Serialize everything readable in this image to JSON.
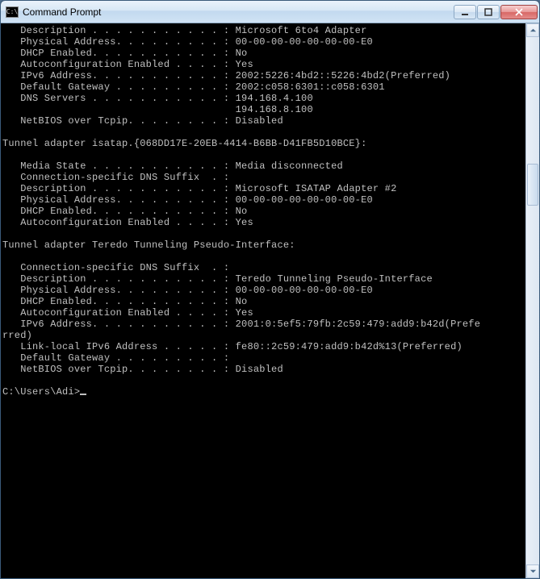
{
  "window": {
    "title": "Command Prompt",
    "icon_label": "C:\\"
  },
  "terminal": {
    "lines": [
      "   Description . . . . . . . . . . . : Microsoft 6to4 Adapter",
      "   Physical Address. . . . . . . . . : 00-00-00-00-00-00-00-E0",
      "   DHCP Enabled. . . . . . . . . . . : No",
      "   Autoconfiguration Enabled . . . . : Yes",
      "   IPv6 Address. . . . . . . . . . . : 2002:5226:4bd2::5226:4bd2(Preferred)",
      "   Default Gateway . . . . . . . . . : 2002:c058:6301::c058:6301",
      "   DNS Servers . . . . . . . . . . . : 194.168.4.100",
      "                                       194.168.8.100",
      "   NetBIOS over Tcpip. . . . . . . . : Disabled",
      "",
      "Tunnel adapter isatap.{068DD17E-20EB-4414-B6BB-D41FB5D10BCE}:",
      "",
      "   Media State . . . . . . . . . . . : Media disconnected",
      "   Connection-specific DNS Suffix  . :",
      "   Description . . . . . . . . . . . : Microsoft ISATAP Adapter #2",
      "   Physical Address. . . . . . . . . : 00-00-00-00-00-00-00-E0",
      "   DHCP Enabled. . . . . . . . . . . : No",
      "   Autoconfiguration Enabled . . . . : Yes",
      "",
      "Tunnel adapter Teredo Tunneling Pseudo-Interface:",
      "",
      "   Connection-specific DNS Suffix  . :",
      "   Description . . . . . . . . . . . : Teredo Tunneling Pseudo-Interface",
      "   Physical Address. . . . . . . . . : 00-00-00-00-00-00-00-E0",
      "   DHCP Enabled. . . . . . . . . . . : No",
      "   Autoconfiguration Enabled . . . . : Yes",
      "   IPv6 Address. . . . . . . . . . . : 2001:0:5ef5:79fb:2c59:479:add9:b42d(Prefe",
      "rred)",
      "   Link-local IPv6 Address . . . . . : fe80::2c59:479:add9:b42d%13(Preferred)",
      "   Default Gateway . . . . . . . . . :",
      "   NetBIOS over Tcpip. . . . . . . . : Disabled",
      ""
    ],
    "prompt": "C:\\Users\\Adi>"
  }
}
